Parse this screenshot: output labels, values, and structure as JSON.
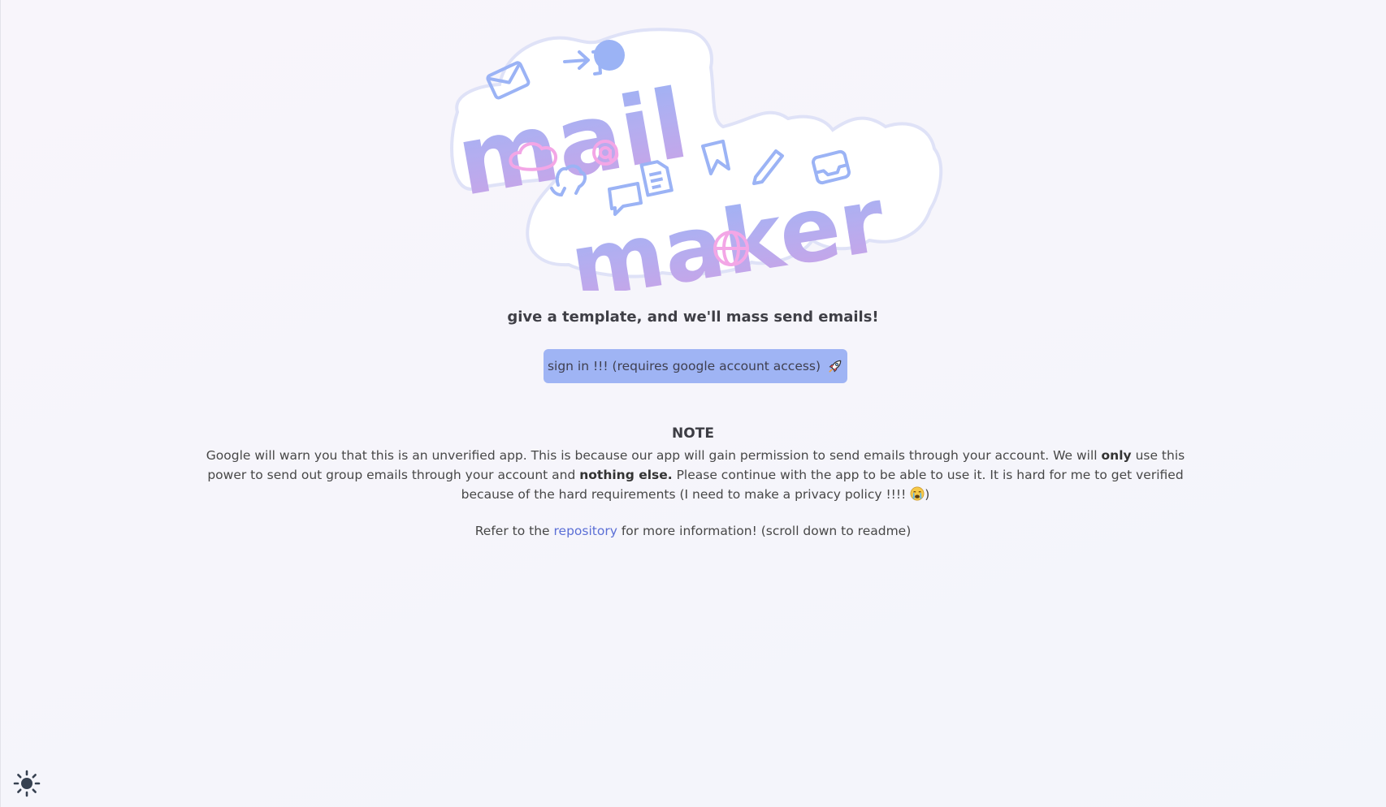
{
  "logo": {
    "word1": "mail",
    "word2": "maker",
    "icons": [
      "envelope-icon",
      "arrow-in-icon",
      "cloud-icon",
      "at-sign-icon",
      "github-icon",
      "chat-bubble-icon",
      "document-icon",
      "bookmark-icon",
      "pencil-icon",
      "inbox-icon",
      "globe-icon"
    ]
  },
  "tagline": "give a template, and we'll mass send emails!",
  "signin_button": {
    "label": "sign in !!! (requires google account access)",
    "icon": "rocket-icon"
  },
  "note": {
    "title": "NOTE",
    "part1": "Google will warn you that this is an unverified app. This is because our app will gain permission to send emails through your account. We will ",
    "bold1": "only",
    "part2": " use this power to send out group emails through your account and ",
    "bold2": "nothing else.",
    "part3": " Please continue with the app to be able to use it. It is hard for me to get verified because of the hard requirements (I need to make a privacy policy !!!! ",
    "emoji": "crying-face-icon",
    "part4": ")"
  },
  "refer": {
    "before": "Refer to the ",
    "link": "repository",
    "after": " for more information! (scroll down to readme)"
  },
  "theme_toggle": {
    "icon": "sun-icon"
  },
  "colors": {
    "accent": "#9fb4f4",
    "link": "#5b6fd6",
    "logo_blue": "#9bb3f5",
    "logo_purple": "#c9a3ea",
    "logo_pink": "#f3a6e6"
  }
}
